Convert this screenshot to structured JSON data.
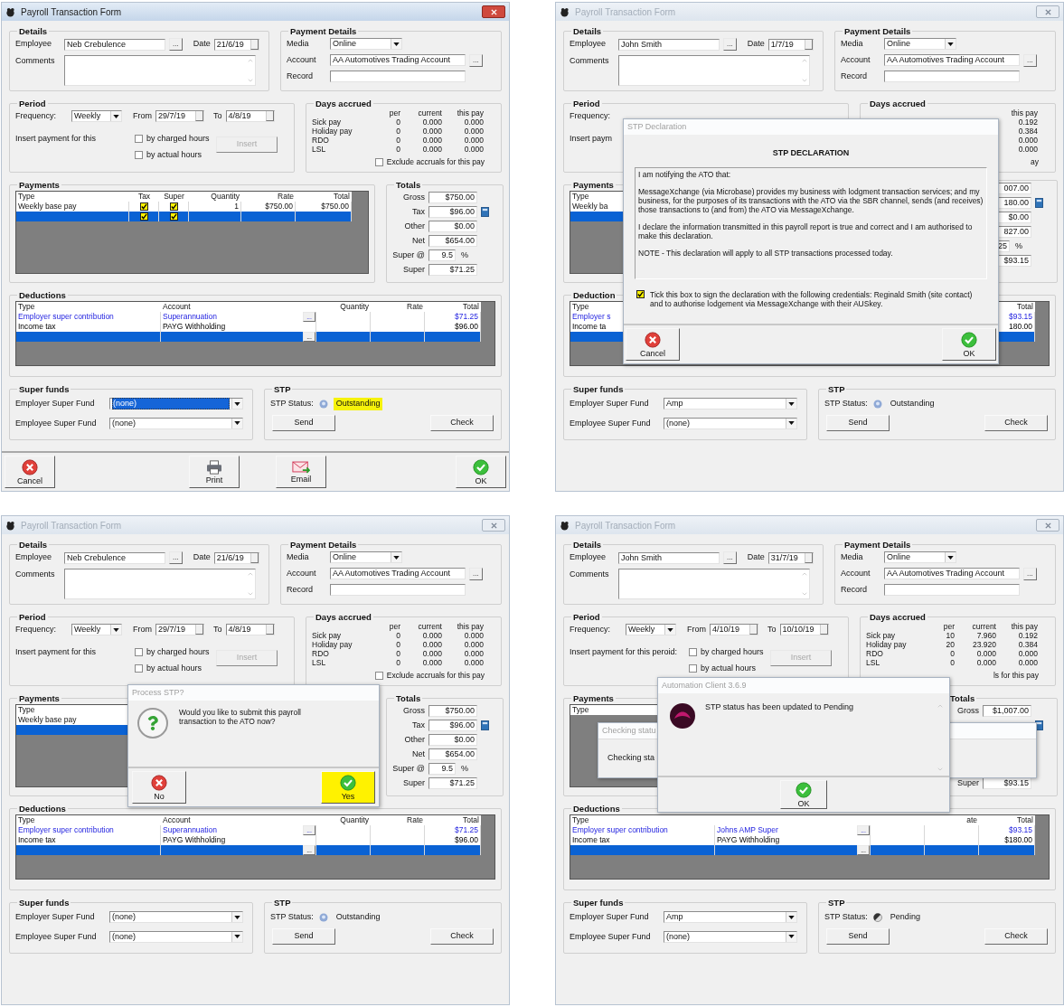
{
  "forms": [
    {
      "title": "Payroll Transaction Form",
      "active": true,
      "details": {
        "title": "Details",
        "employee_label": "Employee",
        "employee": "Neb Crebulence",
        "employee_button": "...",
        "date_label": "Date",
        "date": "21/6/19",
        "comments_label": "Comments"
      },
      "payment_details": {
        "title": "Payment Details",
        "media_label": "Media",
        "media": "Online",
        "account_label": "Account",
        "account": "AA Automotives Trading Account",
        "account_button": "...",
        "record_label": "Record"
      },
      "period": {
        "title": "Period",
        "frequency_label": "Frequency:",
        "frequency": "Weekly",
        "from_label": "From",
        "from": "29/7/19",
        "to_label": "To",
        "to": "4/8/19",
        "insert_label": "Insert payment for this",
        "options": [
          {
            "label": "by charged hours",
            "checked": false
          },
          {
            "label": "by actual hours",
            "checked": false
          }
        ],
        "insert_button": {
          "label": "Insert",
          "disabled": true
        }
      },
      "days_accrued": {
        "title": "Days accrued",
        "columns": {
          "per": "per",
          "current": "current",
          "this_pay": "this pay"
        },
        "rows": [
          {
            "label": "Sick pay",
            "per": "0",
            "current": "0.000",
            "this_pay": "0.000"
          },
          {
            "label": "Holiday pay",
            "per": "0",
            "current": "0.000",
            "this_pay": "0.000"
          },
          {
            "label": "RDO",
            "per": "0",
            "current": "0.000",
            "this_pay": "0.000"
          },
          {
            "label": "LSL",
            "per": "0",
            "current": "0.000",
            "this_pay": "0.000"
          }
        ],
        "exclude": {
          "label": "Exclude accruals for this pay",
          "checked": false
        }
      },
      "payments": {
        "title": "Payments",
        "columns": {
          "type": "Type",
          "tax": "Tax",
          "super": "Super",
          "quantity": "Quantity",
          "rate": "Rate",
          "total": "Total"
        },
        "rows": [
          {
            "selected": false,
            "type": "Weekly base pay",
            "tax": true,
            "super": true,
            "quantity": "1",
            "rate": "$750.00",
            "total": "$750.00"
          },
          {
            "selected": true,
            "tax": true,
            "super": true
          }
        ]
      },
      "totals": {
        "title": "Totals",
        "rows": [
          {
            "kind": "amount",
            "label": "Gross",
            "value": "$750.00"
          },
          {
            "kind": "tax",
            "label": "Tax",
            "value": "$96.00"
          },
          {
            "kind": "amount",
            "label": "Other",
            "value": "$0.00"
          },
          {
            "kind": "amount",
            "label": "Net",
            "value": "$654.00"
          },
          {
            "kind": "rate",
            "label": "Super @",
            "value": "9.5",
            "unit": "%"
          },
          {
            "kind": "amount",
            "label": "Super",
            "value": "$71.25"
          }
        ]
      },
      "deductions": {
        "title": "Deductions",
        "columns": {
          "type": "Type",
          "account": "Account",
          "quantity": "Quantity",
          "rate": "Rate",
          "total": "Total"
        },
        "rows": [
          {
            "selected": false,
            "link": true,
            "type": "Employer super contribution",
            "account": "Superannuation",
            "browse": "...",
            "total": "$71.25"
          },
          {
            "selected": false,
            "link": false,
            "type": "Income tax",
            "account": "PAYG Withholding",
            "total": "$96.00"
          },
          {
            "selected": true,
            "browse": "..."
          }
        ]
      },
      "super_funds": {
        "title": "Super funds",
        "employer_label": "Employer Super Fund",
        "employer": "(none)",
        "employer_focused": true,
        "employee_label": "Employee Super Fund",
        "employee": "(none)"
      },
      "stp": {
        "title": "STP",
        "status_label": "STP Status:",
        "pending": false,
        "status": "Outstanding",
        "highlighted": true,
        "send": "Send",
        "check": "Check"
      },
      "buttons": [
        {
          "kind": "cancel",
          "label": "Cancel"
        },
        {
          "kind": "print",
          "label": "Print"
        },
        {
          "kind": "email",
          "label": "Email"
        },
        {
          "kind": "ok",
          "label": "OK"
        }
      ]
    },
    {
      "title": "Payroll Transaction Form",
      "active": false,
      "details": {
        "title": "Details",
        "employee_label": "Employee",
        "employee": "John Smith",
        "employee_button": "...",
        "date_label": "Date",
        "date": "1/7/19",
        "comments_label": "Comments"
      },
      "payment_details": {
        "title": "Payment Details",
        "media_label": "Media",
        "media": "Online",
        "account_label": "Account",
        "account": "AA Automotives Trading Account",
        "account_button": "...",
        "record_label": "Record"
      },
      "period": {
        "title": "Period",
        "frequency_label": "Frequency:",
        "insert_label": "Insert paym"
      },
      "days_accrued": {
        "title": "Days accrued",
        "columns": {
          "this_pay": "this pay"
        },
        "rows": [
          {
            "this_pay": "0.192"
          },
          {
            "this_pay": "0.384"
          },
          {
            "this_pay": "0.000"
          },
          {
            "this_pay": "0.000"
          }
        ],
        "exclude": {
          "label": "ay"
        }
      },
      "payments": {
        "title": "Payments",
        "columns": {
          "type": "Type"
        },
        "rows": [
          {
            "selected": false,
            "type": "Weekly ba"
          },
          {
            "selected": true
          }
        ]
      },
      "totals": {
        "rows": [
          {
            "kind": "amount",
            "value": "007.00"
          },
          {
            "kind": "tax",
            "value": "180.00"
          },
          {
            "kind": "amount",
            "value": "$0.00"
          },
          {
            "kind": "amount",
            "value": "827.00"
          },
          {
            "kind": "rate",
            "value": "25",
            "unit": "%"
          },
          {
            "kind": "amount",
            "value": "$93.15"
          }
        ]
      },
      "deductions": {
        "title": "Deduction",
        "columns": {
          "type": "Type",
          "total": "Total"
        },
        "rows": [
          {
            "selected": false,
            "link": true,
            "type": "Employer s",
            "total": "$93.15"
          },
          {
            "selected": false,
            "link": false,
            "type": "Income ta",
            "total": "180.00"
          },
          {
            "selected": true
          }
        ]
      },
      "super_funds": {
        "title": "Super funds",
        "employer_label": "Employer Super Fund",
        "employer": "Amp",
        "employer_focused": false,
        "employee_label": "Employee Super Fund",
        "employee": "(none)"
      },
      "stp": {
        "title": "STP",
        "status_label": "STP Status:",
        "pending": false,
        "status": "Outstanding",
        "highlighted": false,
        "send": "Send",
        "check": "Check"
      },
      "dialogs": [
        {
          "kind": "declaration",
          "title": "STP Declaration",
          "heading": "STP DECLARATION",
          "paragraphs": [
            "I am notifying the ATO that:",
            "MessageXchange (via Microbase) provides my business with lodgment transaction services; and my business, for the purposes of its transactions with the ATO via the SBR channel, sends (and receives) those transactions to (and from) the ATO via MessageXchange.",
            "I declare the information transmitted in this payroll report is true and correct and I am authorised to make this declaration.",
            "NOTE - This declaration will apply to all STP transactions processed today."
          ],
          "confirm": {
            "label": "Tick this box to sign the declaration with the following credentials: Reginald Smith (site contact) and to authorise lodgement via MessageXchange with their AUSkey.",
            "checked": true
          },
          "buttons": [
            {
              "kind": "cancel",
              "label": "Cancel"
            },
            {
              "kind": "ok",
              "label": "OK"
            }
          ]
        }
      ]
    },
    {
      "title": "Payroll Transaction Form",
      "active": false,
      "details": {
        "title": "Details",
        "employee_label": "Employee",
        "employee": "Neb Crebulence",
        "employee_button": "...",
        "date_label": "Date",
        "date": "21/6/19",
        "comments_label": "Comments"
      },
      "payment_details": {
        "title": "Payment Details",
        "media_label": "Media",
        "media": "Online",
        "account_label": "Account",
        "account": "AA Automotives Trading Account",
        "account_button": "...",
        "record_label": "Record"
      },
      "period": {
        "title": "Period",
        "frequency_label": "Frequency:",
        "frequency": "Weekly",
        "from_label": "From",
        "from": "29/7/19",
        "to_label": "To",
        "to": "4/8/19",
        "insert_label": "Insert payment for this",
        "options": [
          {
            "label": "by charged hours",
            "checked": false
          },
          {
            "label": "by actual hours",
            "checked": false
          }
        ],
        "insert_button": {
          "label": "Insert",
          "disabled": true
        }
      },
      "days_accrued": {
        "title": "Days accrued",
        "columns": {
          "per": "per",
          "current": "current",
          "this_pay": "this pay"
        },
        "rows": [
          {
            "label": "Sick pay",
            "per": "0",
            "current": "0.000",
            "this_pay": "0.000"
          },
          {
            "label": "Holiday pay",
            "per": "0",
            "current": "0.000",
            "this_pay": "0.000"
          },
          {
            "label": "RDO",
            "per": "0",
            "current": "0.000",
            "this_pay": "0.000"
          },
          {
            "label": "LSL",
            "per": "0",
            "current": "0.000",
            "this_pay": "0.000"
          }
        ],
        "exclude": {
          "label": "Exclude accruals for this pay",
          "checked": false
        }
      },
      "payments": {
        "title": "Payments",
        "columns": {
          "type": "Type"
        },
        "rows": [
          {
            "selected": false,
            "type": "Weekly base pay"
          },
          {
            "selected": true
          }
        ]
      },
      "totals": {
        "title": "Totals",
        "rows": [
          {
            "kind": "amount",
            "label": "Gross",
            "value": "$750.00"
          },
          {
            "kind": "tax",
            "label": "Tax",
            "value": "$96.00"
          },
          {
            "kind": "amount",
            "label": "Other",
            "value": "$0.00"
          },
          {
            "kind": "amount",
            "label": "Net",
            "value": "$654.00"
          },
          {
            "kind": "rate",
            "label": "Super @",
            "value": "9.5",
            "unit": "%"
          },
          {
            "kind": "amount",
            "label": "Super",
            "value": "$71.25"
          }
        ]
      },
      "deductions": {
        "title": "Deductions",
        "columns": {
          "type": "Type",
          "account": "Account",
          "quantity": "Quantity",
          "rate": "Rate",
          "total": "Total"
        },
        "rows": [
          {
            "selected": false,
            "link": true,
            "type": "Employer super contribution",
            "account": "Superannuation",
            "browse": "...",
            "total": "$71.25"
          },
          {
            "selected": false,
            "link": false,
            "type": "Income tax",
            "account": "PAYG Withholding",
            "total": "$96.00"
          },
          {
            "selected": true,
            "browse": "..."
          }
        ]
      },
      "super_funds": {
        "title": "Super funds",
        "employer_label": "Employer Super Fund",
        "employer": "(none)",
        "employer_focused": false,
        "employee_label": "Employee Super Fund",
        "employee": "(none)"
      },
      "stp": {
        "title": "STP",
        "status_label": "STP Status:",
        "pending": false,
        "status": "Outstanding",
        "highlighted": false,
        "send": "Send",
        "check": "Check"
      },
      "dialogs": [
        {
          "kind": "question",
          "title": "Process STP?",
          "message": "Would you like to submit this payroll transaction to the ATO now?",
          "buttons": [
            {
              "kind": "cancel",
              "label": "No",
              "highlighted": false
            },
            {
              "kind": "ok",
              "label": "Yes",
              "highlighted": true
            }
          ]
        }
      ]
    },
    {
      "title": "Payroll Transaction Form",
      "active": false,
      "details": {
        "title": "Details",
        "employee_label": "Employee",
        "employee": "John Smith",
        "employee_button": "...",
        "date_label": "Date",
        "date": "31/7/19",
        "comments_label": "Comments"
      },
      "payment_details": {
        "title": "Payment Details",
        "media_label": "Media",
        "media": "Online",
        "account_label": "Account",
        "account": "AA Automotives Trading Account",
        "account_button": "...",
        "record_label": "Record"
      },
      "period": {
        "title": "Period",
        "frequency_label": "Frequency:",
        "frequency": "Weekly",
        "from_label": "From",
        "from": "4/10/19",
        "to_label": "To",
        "to": "10/10/19",
        "insert_label": "Insert payment for this peroid:",
        "options": [
          {
            "label": "by charged hours",
            "checked": false
          },
          {
            "label": "by actual hours",
            "checked": false
          }
        ],
        "insert_button": {
          "label": "Insert",
          "disabled": true
        }
      },
      "days_accrued": {
        "title": "Days accrued",
        "columns": {
          "per": "per",
          "current": "current",
          "this_pay": "this pay"
        },
        "rows": [
          {
            "label": "Sick pay",
            "per": "10",
            "current": "7.960",
            "this_pay": "0.192"
          },
          {
            "label": "Holiday pay",
            "per": "20",
            "current": "23.920",
            "this_pay": "0.384"
          },
          {
            "label": "RDO",
            "per": "0",
            "current": "0.000",
            "this_pay": "0.000"
          },
          {
            "label": "LSL",
            "per": "0",
            "current": "0.000",
            "this_pay": "0.000"
          }
        ],
        "exclude": {
          "label": "ls for this pay"
        }
      },
      "payments": {
        "title": "Payments",
        "columns": {
          "type": "Type"
        }
      },
      "totals": {
        "title": "Totals",
        "rows": [
          {
            "kind": "amount",
            "label": "Gross",
            "value": "$1,007.00"
          },
          {
            "kind": "tax"
          },
          {},
          {},
          {},
          {
            "kind": "amount",
            "label": "Super",
            "value": "$93.15"
          }
        ]
      },
      "deductions": {
        "title": "Deductions",
        "columns": {
          "type": "Type",
          "rate": "ate",
          "total": "Total"
        },
        "rows": [
          {
            "selected": false,
            "link": true,
            "type": "Employer super contribution",
            "account": "Johns AMP Super",
            "browse": "...",
            "total": "$93.15"
          },
          {
            "selected": false,
            "link": false,
            "type": "Income tax",
            "account": "PAYG Withholding",
            "total": "$180.00"
          },
          {
            "selected": true,
            "browse": "..."
          }
        ]
      },
      "super_funds": {
        "title": "Super funds",
        "employer_label": "Employer Super Fund",
        "employer": "Amp",
        "employer_focused": false,
        "employee_label": "Employee Super Fund",
        "employee": "(none)"
      },
      "stp": {
        "title": "STP",
        "status_label": "STP Status:",
        "pending": true,
        "status": "Pending",
        "highlighted": false,
        "send": "Send",
        "check": "Check"
      },
      "dialogs": [
        {
          "kind": "progress",
          "title": "Checking statu",
          "message": "Checking sta"
        },
        {
          "kind": "message",
          "title": "Automation Client 3.6.9",
          "message": "STP status has been updated to Pending",
          "buttons": [
            {
              "kind": "ok",
              "label": "OK"
            }
          ]
        }
      ]
    }
  ]
}
